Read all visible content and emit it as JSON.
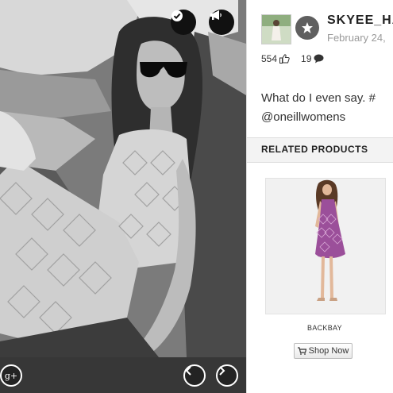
{
  "post": {
    "username": "SKYEE_HA",
    "date": "February 24,",
    "likes": "554",
    "comments": "19",
    "caption_line1": "What do I even say. #",
    "caption_line2": "@oneillwomens"
  },
  "related": {
    "title": "RELATED PRODUCTS",
    "product_name": "BACKBAY",
    "shop_label": "Shop Now"
  },
  "icons": {
    "check": "check-circle-icon",
    "megaphone": "megaphone-icon",
    "gplus": "google-plus-icon",
    "prev": "chevron-left-icon",
    "next": "chevron-right-icon",
    "like": "thumbs-up-icon",
    "comment": "speech-bubble-icon",
    "cart": "cart-icon",
    "star": "star-icon"
  },
  "colors": {
    "accent_dark": "#111111",
    "product_dress": "#9b4f9a",
    "badge_gray": "#5f5f5f"
  }
}
